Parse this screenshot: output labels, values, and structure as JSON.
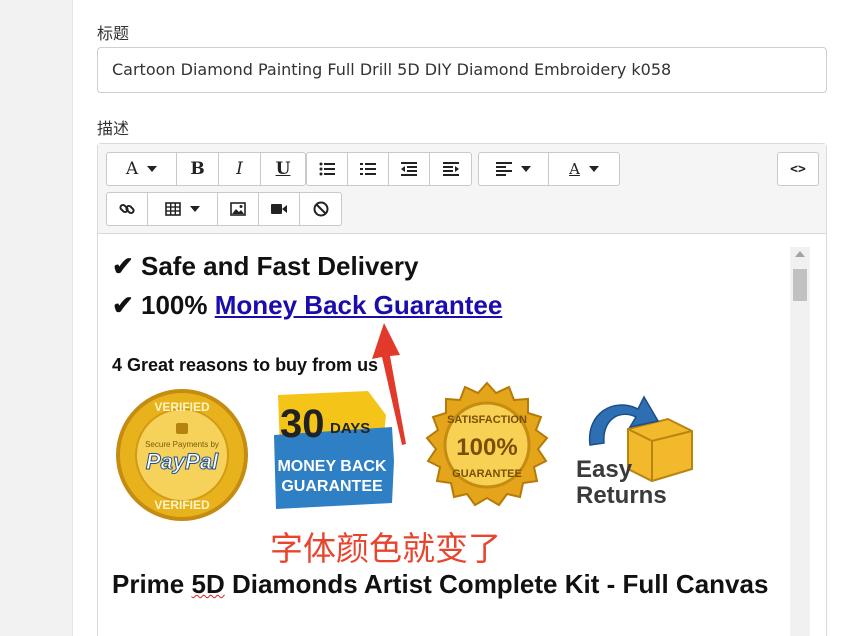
{
  "form": {
    "title_label": "标题",
    "title_value": "Cartoon Diamond Painting Full Drill 5D DIY Diamond Embroidery  k058",
    "desc_label": "描述"
  },
  "toolbar": {
    "row1": [
      {
        "icon": "font-style-icon",
        "glyph": "A",
        "dropdown": true
      },
      {
        "icon": "bold-icon",
        "glyph": "B"
      },
      {
        "icon": "italic-icon",
        "glyph": "I"
      },
      {
        "icon": "underline-icon",
        "glyph": "U"
      },
      {
        "icon": "unordered-list-icon"
      },
      {
        "icon": "ordered-list-icon"
      },
      {
        "icon": "outdent-icon"
      },
      {
        "icon": "indent-icon"
      },
      {
        "icon": "paragraph-align-icon",
        "dropdown": true
      },
      {
        "icon": "font-color-icon",
        "glyph": "A",
        "dropdown": true
      }
    ],
    "row2": [
      {
        "icon": "link-icon"
      },
      {
        "icon": "table-icon",
        "dropdown": true
      },
      {
        "icon": "image-icon"
      },
      {
        "icon": "video-icon"
      },
      {
        "icon": "clear-format-icon"
      }
    ],
    "code_view_label": "<>"
  },
  "content": {
    "line1": "✔ Safe and Fast Delivery",
    "line2_prefix": "✔ 100% ",
    "line2_link": "Money Back Guarantee",
    "reasons": "4 Great reasons to buy from us",
    "badges": {
      "paypal": {
        "top": "VERIFIED",
        "middle": "Secure Payments by",
        "brand": "PayPal",
        "bottom": "VERIFIED"
      },
      "moneyback": {
        "number": "30",
        "days": "DAYS",
        "line1": "MONEY BACK",
        "line2": "GUARANTEE"
      },
      "satisfaction": {
        "top": "SATISFACTION",
        "percent": "100%",
        "bottom": "GUARANTEE"
      },
      "returns": {
        "line1": "Easy",
        "line2": "Returns"
      }
    },
    "prime_pre": "Prime ",
    "prime_squiggle": "5D",
    "prime_post": " Diamonds Artist Complete Kit - Full Canvas"
  },
  "annotation": {
    "text": "字体颜色就变了",
    "color": "#e8452f"
  },
  "colors": {
    "link": "#1a0dab",
    "gold": "#e8b21c",
    "blue_badge": "#2e7fc4"
  }
}
